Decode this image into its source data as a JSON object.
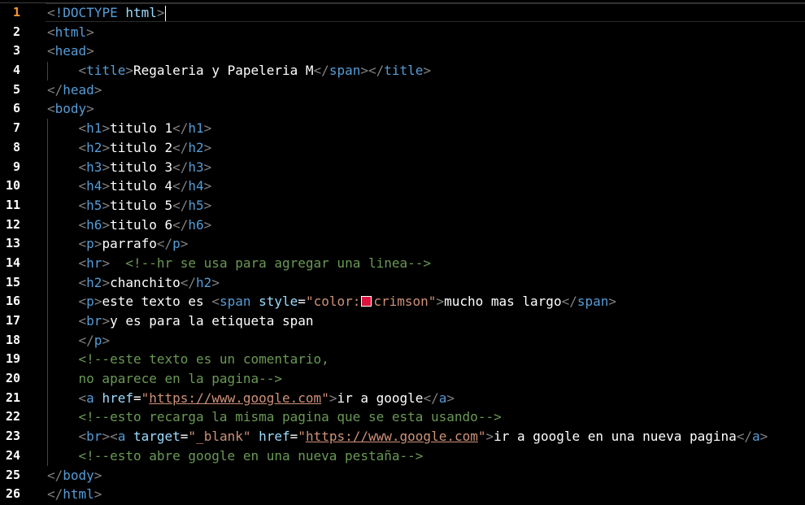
{
  "editor": {
    "active_line": 1,
    "swatch_color": "#dc143c",
    "lines": [
      {
        "number": "1",
        "tokens": [
          [
            "t-punct",
            "<"
          ],
          [
            "t-doctype",
            "!DOCTYPE"
          ],
          [
            "t-text",
            " "
          ],
          [
            "t-doctype-name",
            "html"
          ],
          [
            "t-punct",
            ">"
          ]
        ],
        "cursor": true
      },
      {
        "number": "2",
        "tokens": [
          [
            "t-punct",
            "<"
          ],
          [
            "t-tag",
            "html"
          ],
          [
            "t-punct",
            ">"
          ]
        ]
      },
      {
        "number": "3",
        "tokens": [
          [
            "t-punct",
            "<"
          ],
          [
            "t-tag",
            "head"
          ],
          [
            "t-punct",
            ">"
          ]
        ]
      },
      {
        "number": "4",
        "tokens": [
          [
            "t-text",
            "    "
          ],
          [
            "t-punct",
            "<"
          ],
          [
            "t-tag",
            "title"
          ],
          [
            "t-punct",
            ">"
          ],
          [
            "t-text",
            "Regaleria y Papeleria M"
          ],
          [
            "t-punct",
            "</"
          ],
          [
            "t-tag",
            "span"
          ],
          [
            "t-punct",
            "></"
          ],
          [
            "t-tag",
            "title"
          ],
          [
            "t-punct",
            ">"
          ]
        ]
      },
      {
        "number": "5",
        "tokens": [
          [
            "t-punct",
            "</"
          ],
          [
            "t-tag",
            "head"
          ],
          [
            "t-punct",
            ">"
          ]
        ]
      },
      {
        "number": "6",
        "tokens": [
          [
            "t-punct",
            "<"
          ],
          [
            "t-tag",
            "body"
          ],
          [
            "t-punct",
            ">"
          ]
        ]
      },
      {
        "number": "7",
        "tokens": [
          [
            "t-text",
            "    "
          ],
          [
            "t-punct",
            "<"
          ],
          [
            "t-tag",
            "h1"
          ],
          [
            "t-punct",
            ">"
          ],
          [
            "t-text",
            "titulo 1"
          ],
          [
            "t-punct",
            "</"
          ],
          [
            "t-tag",
            "h1"
          ],
          [
            "t-punct",
            ">"
          ]
        ]
      },
      {
        "number": "8",
        "tokens": [
          [
            "t-text",
            "    "
          ],
          [
            "t-punct",
            "<"
          ],
          [
            "t-tag",
            "h2"
          ],
          [
            "t-punct",
            ">"
          ],
          [
            "t-text",
            "titulo 2"
          ],
          [
            "t-punct",
            "</"
          ],
          [
            "t-tag",
            "h2"
          ],
          [
            "t-punct",
            ">"
          ]
        ]
      },
      {
        "number": "9",
        "tokens": [
          [
            "t-text",
            "    "
          ],
          [
            "t-punct",
            "<"
          ],
          [
            "t-tag",
            "h3"
          ],
          [
            "t-punct",
            ">"
          ],
          [
            "t-text",
            "titulo 3"
          ],
          [
            "t-punct",
            "</"
          ],
          [
            "t-tag",
            "h3"
          ],
          [
            "t-punct",
            ">"
          ]
        ]
      },
      {
        "number": "10",
        "tokens": [
          [
            "t-text",
            "    "
          ],
          [
            "t-punct",
            "<"
          ],
          [
            "t-tag",
            "h4"
          ],
          [
            "t-punct",
            ">"
          ],
          [
            "t-text",
            "titulo 4"
          ],
          [
            "t-punct",
            "</"
          ],
          [
            "t-tag",
            "h4"
          ],
          [
            "t-punct",
            ">"
          ]
        ]
      },
      {
        "number": "11",
        "tokens": [
          [
            "t-text",
            "    "
          ],
          [
            "t-punct",
            "<"
          ],
          [
            "t-tag",
            "h5"
          ],
          [
            "t-punct",
            ">"
          ],
          [
            "t-text",
            "titulo 5"
          ],
          [
            "t-punct",
            "</"
          ],
          [
            "t-tag",
            "h5"
          ],
          [
            "t-punct",
            ">"
          ]
        ]
      },
      {
        "number": "12",
        "tokens": [
          [
            "t-text",
            "    "
          ],
          [
            "t-punct",
            "<"
          ],
          [
            "t-tag",
            "h6"
          ],
          [
            "t-punct",
            ">"
          ],
          [
            "t-text",
            "titulo 6"
          ],
          [
            "t-punct",
            "</"
          ],
          [
            "t-tag",
            "h6"
          ],
          [
            "t-punct",
            ">"
          ]
        ]
      },
      {
        "number": "13",
        "tokens": [
          [
            "t-text",
            "    "
          ],
          [
            "t-punct",
            "<"
          ],
          [
            "t-tag",
            "p"
          ],
          [
            "t-punct",
            ">"
          ],
          [
            "t-text",
            "parrafo"
          ],
          [
            "t-punct",
            "</"
          ],
          [
            "t-tag",
            "p"
          ],
          [
            "t-punct",
            ">"
          ]
        ]
      },
      {
        "number": "14",
        "tokens": [
          [
            "t-text",
            "    "
          ],
          [
            "t-punct",
            "<"
          ],
          [
            "t-tag",
            "hr"
          ],
          [
            "t-punct",
            ">"
          ],
          [
            "t-text",
            "  "
          ],
          [
            "t-comment",
            "<!--hr se usa para agregar una linea-->"
          ]
        ]
      },
      {
        "number": "15",
        "tokens": [
          [
            "t-text",
            "    "
          ],
          [
            "t-punct",
            "<"
          ],
          [
            "t-tag",
            "h2"
          ],
          [
            "t-punct",
            ">"
          ],
          [
            "t-text",
            "chanchito"
          ],
          [
            "t-punct",
            "</"
          ],
          [
            "t-tag",
            "h2"
          ],
          [
            "t-punct",
            ">"
          ]
        ]
      },
      {
        "number": "16",
        "tokens": [
          [
            "t-text",
            "    "
          ],
          [
            "t-punct",
            "<"
          ],
          [
            "t-tag",
            "p"
          ],
          [
            "t-punct",
            ">"
          ],
          [
            "t-text",
            "este texto es "
          ],
          [
            "t-punct",
            "<"
          ],
          [
            "t-tag",
            "span"
          ],
          [
            "t-text",
            " "
          ],
          [
            "t-attr",
            "style"
          ],
          [
            "t-text",
            "="
          ],
          [
            "t-str",
            "\"color:"
          ],
          [
            "swatch",
            ""
          ],
          [
            "t-str",
            "crimson\""
          ],
          [
            "t-punct",
            ">"
          ],
          [
            "t-text",
            "mucho mas largo"
          ],
          [
            "t-punct",
            "</"
          ],
          [
            "t-tag",
            "span"
          ],
          [
            "t-punct",
            ">"
          ]
        ]
      },
      {
        "number": "17",
        "tokens": [
          [
            "t-text",
            "    "
          ],
          [
            "t-punct",
            "<"
          ],
          [
            "t-tag",
            "br"
          ],
          [
            "t-punct",
            ">"
          ],
          [
            "t-text",
            "y es para la etiqueta span"
          ]
        ]
      },
      {
        "number": "18",
        "tokens": [
          [
            "t-text",
            "    "
          ],
          [
            "t-punct",
            "</"
          ],
          [
            "t-tag",
            "p"
          ],
          [
            "t-punct",
            ">"
          ]
        ]
      },
      {
        "number": "19",
        "tokens": [
          [
            "t-text",
            "    "
          ],
          [
            "t-comment",
            "<!--este texto es un comentario,"
          ]
        ]
      },
      {
        "number": "20",
        "tokens": [
          [
            "t-text",
            "    "
          ],
          [
            "t-comment",
            "no aparece en la pagina-->"
          ]
        ]
      },
      {
        "number": "21",
        "tokens": [
          [
            "t-text",
            "    "
          ],
          [
            "t-punct",
            "<"
          ],
          [
            "t-tag",
            "a"
          ],
          [
            "t-text",
            " "
          ],
          [
            "t-attr",
            "href"
          ],
          [
            "t-text",
            "="
          ],
          [
            "t-str",
            "\""
          ],
          [
            "t-url",
            "https://www.google.com"
          ],
          [
            "t-str",
            "\""
          ],
          [
            "t-punct",
            ">"
          ],
          [
            "t-text",
            "ir a google"
          ],
          [
            "t-punct",
            "</"
          ],
          [
            "t-tag",
            "a"
          ],
          [
            "t-punct",
            ">"
          ]
        ]
      },
      {
        "number": "22",
        "tokens": [
          [
            "t-text",
            "    "
          ],
          [
            "t-comment",
            "<!--esto recarga la misma pagina que se esta usando-->"
          ]
        ]
      },
      {
        "number": "23",
        "tokens": [
          [
            "t-text",
            "    "
          ],
          [
            "t-punct",
            "<"
          ],
          [
            "t-tag",
            "br"
          ],
          [
            "t-punct",
            "><"
          ],
          [
            "t-tag",
            "a"
          ],
          [
            "t-text",
            " "
          ],
          [
            "t-attr",
            "target"
          ],
          [
            "t-text",
            "="
          ],
          [
            "t-str",
            "\"_blank\""
          ],
          [
            "t-text",
            " "
          ],
          [
            "t-attr",
            "href"
          ],
          [
            "t-text",
            "="
          ],
          [
            "t-str",
            "\""
          ],
          [
            "t-url",
            "https://www.google.com"
          ],
          [
            "t-str",
            "\""
          ],
          [
            "t-punct",
            ">"
          ],
          [
            "t-text",
            "ir a google en una nueva pagina"
          ],
          [
            "t-punct",
            "</"
          ],
          [
            "t-tag",
            "a"
          ],
          [
            "t-punct",
            ">"
          ]
        ]
      },
      {
        "number": "24",
        "tokens": [
          [
            "t-text",
            "    "
          ],
          [
            "t-comment",
            "<!--esto abre google en una nueva pestaña-->"
          ]
        ]
      },
      {
        "number": "25",
        "tokens": [
          [
            "t-punct",
            "</"
          ],
          [
            "t-tag",
            "body"
          ],
          [
            "t-punct",
            ">"
          ]
        ]
      },
      {
        "number": "26",
        "tokens": [
          [
            "t-punct",
            "</"
          ],
          [
            "t-tag",
            "html"
          ],
          [
            "t-punct",
            ">"
          ]
        ]
      }
    ]
  }
}
